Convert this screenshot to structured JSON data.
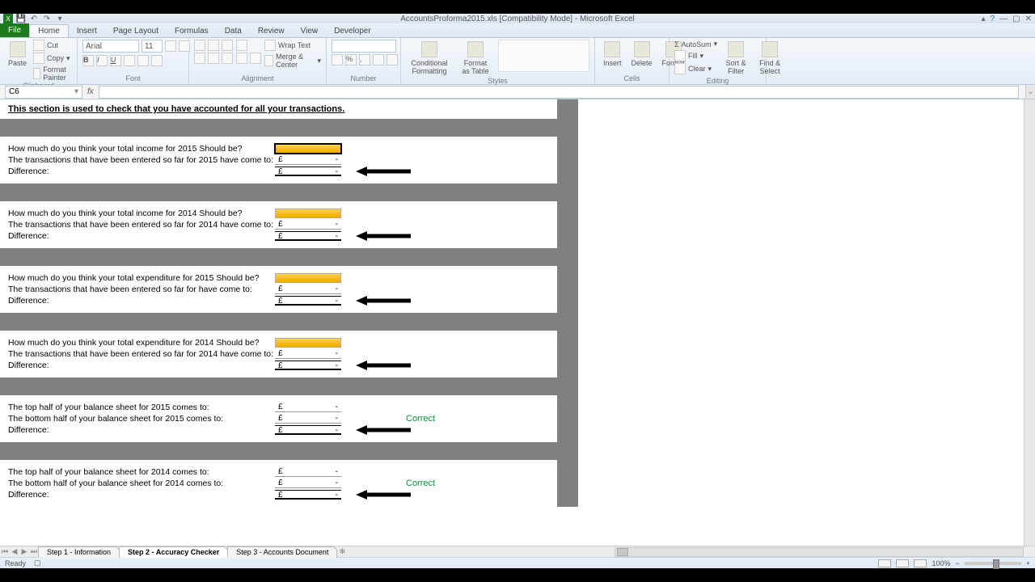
{
  "title": "AccountsProforma2015.xls  [Compatibility Mode] - Microsoft Excel",
  "ribbon": {
    "file": "File",
    "tabs": [
      "Home",
      "Insert",
      "Page Layout",
      "Formulas",
      "Data",
      "Review",
      "View",
      "Developer"
    ],
    "active_tab": "Home",
    "groups": {
      "clipboard": {
        "label": "Clipboard",
        "paste": "Paste",
        "cut": "Cut",
        "copy": "Copy",
        "fmtpainter": "Format Painter"
      },
      "font": {
        "label": "Font",
        "name": "Arial",
        "size": "11"
      },
      "alignment": {
        "label": "Alignment",
        "wrap": "Wrap Text",
        "merge": "Merge & Center"
      },
      "number": {
        "label": "Number"
      },
      "styles": {
        "label": "Styles",
        "cond": "Conditional Formatting",
        "table": "Format as Table"
      },
      "cells": {
        "label": "Cells",
        "insert": "Insert",
        "delete": "Delete",
        "format": "Format"
      },
      "editing": {
        "label": "Editing",
        "autosum": "AutoSum",
        "fill": "Fill",
        "clear": "Clear",
        "sort": "Sort & Filter",
        "find": "Find & Select"
      }
    }
  },
  "namebox": "C6",
  "section_title": "This section is used to check that you have accounted for all your transactions.",
  "blocks": [
    {
      "q": "How much do you think your total income for 2015 Should be?",
      "t": "The transactions that have been entered so far for 2015 have come to:",
      "d": "Difference:"
    },
    {
      "q": "How much do you think your total income for 2014 Should be?",
      "t": "The transactions that have been entered so far for 2014 have come to:",
      "d": "Difference:"
    },
    {
      "q": "How much do you think your total expenditure for 2015 Should be?",
      "t": "The transactions that have been entered so far for  have come to:",
      "d": "Difference:"
    },
    {
      "q": "How much do you think your total expenditure for 2014 Should be?",
      "t": "The transactions that have been entered so far for 2014 have come to:",
      "d": "Difference:"
    }
  ],
  "balance_blocks": [
    {
      "top": "The top half of your balance sheet for 2015 comes to:",
      "bottom": "The bottom half of your balance sheet for 2015 comes to:",
      "d": "Difference:",
      "status": "Correct"
    },
    {
      "top": "The top half of your balance sheet for 2014 comes to:",
      "bottom": "The bottom half of your balance sheet for 2014 comes to:",
      "d": "Difference:",
      "status": "Correct"
    }
  ],
  "currency": "£",
  "sheet_tabs": [
    "Step 1 - Information",
    "Step 2 - Accuracy Checker",
    "Step 3 - Accounts Document"
  ],
  "active_sheet": "Step 2 - Accuracy Checker",
  "status": {
    "ready": "Ready",
    "zoom": "100%"
  }
}
